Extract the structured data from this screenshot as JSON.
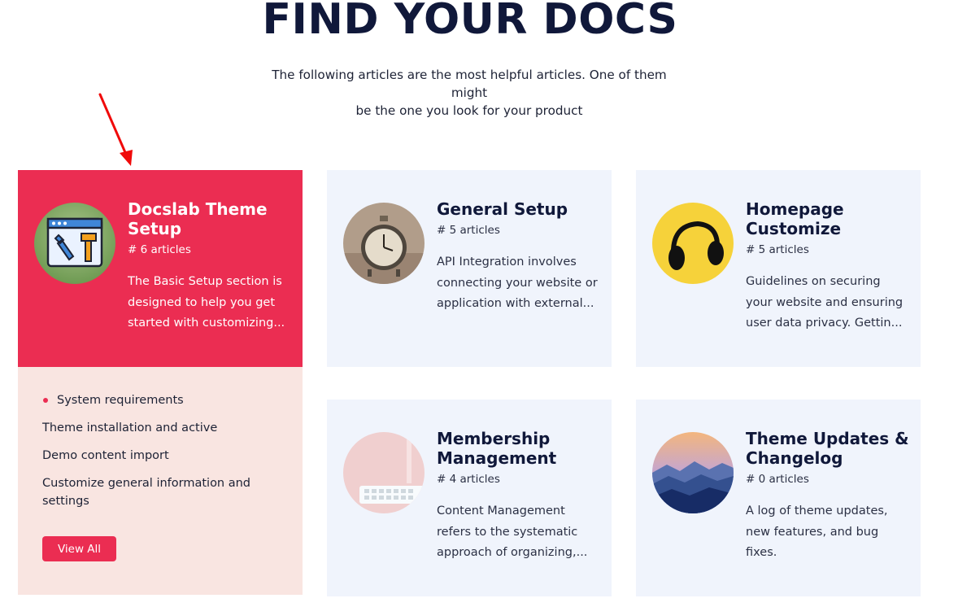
{
  "header": {
    "title": "FIND YOUR DOCS",
    "subtitle_line1": "The following articles are the most helpful articles. One of them might",
    "subtitle_line2": "be the one you look for your product"
  },
  "colors": {
    "accent": "#eb2d52",
    "card_bg": "#f0f4fc",
    "active_list_bg": "#f9e5e1",
    "heading": "#10183a"
  },
  "cards": [
    {
      "title": "Docslab Theme Setup",
      "count": "# 6 articles",
      "desc_line1": "The Basic Setup section is",
      "desc_line2": "designed to help you get",
      "desc_line3": "started with customizing...",
      "icon": "tools-window-icon",
      "docs": [
        "System requirements",
        "Theme installation and active",
        "Demo content import",
        "Customize general information and settings"
      ],
      "button": "View All"
    },
    {
      "title": "General Setup",
      "count": "# 5 articles",
      "desc_line1": "API Integration involves",
      "desc_line2": "connecting your website or",
      "desc_line3": "application with external...",
      "icon": "alarm-clock-icon"
    },
    {
      "title": "Homepage Customize",
      "count": "# 5 articles",
      "desc_line1": "Guidelines on securing",
      "desc_line2": "your website and ensuring",
      "desc_line3": "user data privacy. Gettin...",
      "icon": "headphones-icon"
    },
    {
      "title": "Membership Management",
      "count": "# 4 articles",
      "desc_line1": "Content Management",
      "desc_line2": "refers to the systematic",
      "desc_line3": "approach of organizing,...",
      "icon": "keyboard-icon"
    },
    {
      "title": "Theme Updates & Changelog",
      "count": "# 0 articles",
      "desc_line1": "A log of theme updates,",
      "desc_line2": "new features, and bug",
      "desc_line3": "fixes.",
      "icon": "mountains-icon"
    }
  ]
}
